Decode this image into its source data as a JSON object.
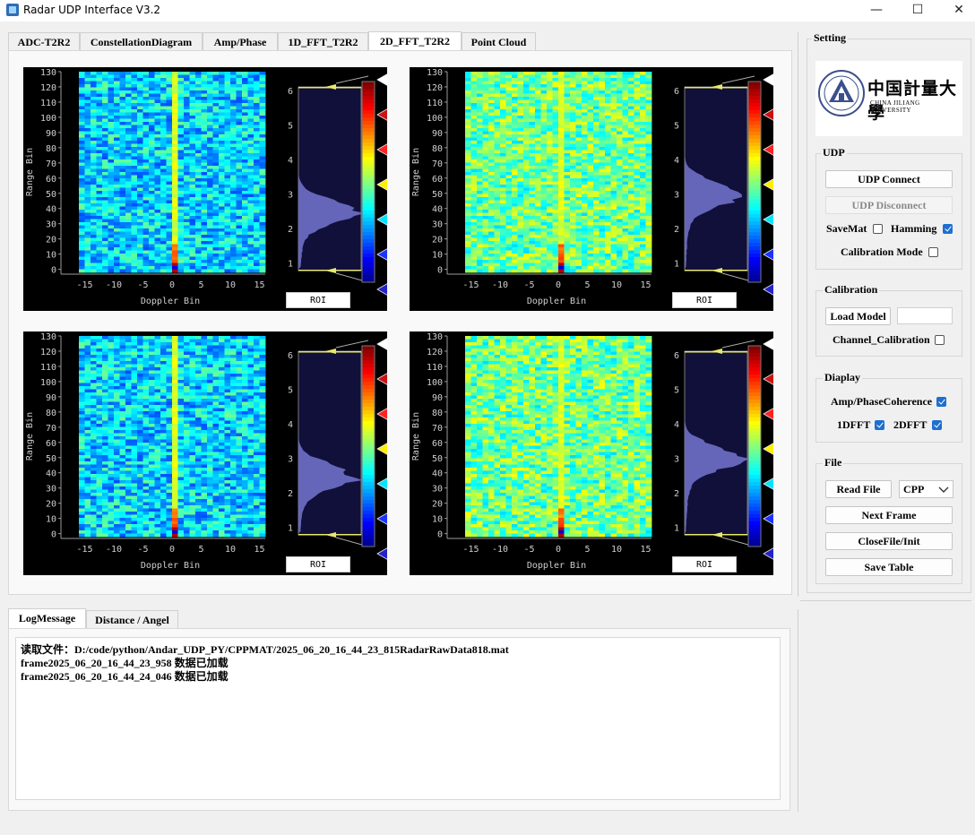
{
  "window": {
    "title": "Radar UDP Interface V3.2",
    "minimize": "—",
    "maximize": "☐",
    "close": "✕"
  },
  "tabs": [
    "ADC-T2R2",
    "ConstellationDiagram",
    "Amp/Phase",
    "1D_FFT_T2R2",
    "2D_FFT_T2R2",
    "Point Cloud"
  ],
  "active_tab": "2D_FFT_T2R2",
  "plots": {
    "y_ticks": [
      "130",
      "120",
      "110",
      "100",
      "90",
      "80",
      "70",
      "60",
      "50",
      "40",
      "30",
      "20",
      "10",
      "0"
    ],
    "x_ticks": [
      "-15",
      "-10",
      "-5",
      "0",
      "5",
      "10",
      "15"
    ],
    "xlabel": "Doppler Bin",
    "ylabel": "Range Bin",
    "hist_ticks": [
      "6",
      "5",
      "4",
      "3",
      "2",
      "1"
    ],
    "roi_label": "ROI"
  },
  "settings": {
    "title": "Setting",
    "logo_cn": "中国計量大學",
    "logo_en": "CHINA JILIANG UNIVERSITY",
    "udp": {
      "title": "UDP",
      "connect": "UDP Connect",
      "disconnect": "UDP Disconnect",
      "savemat": "SaveMat",
      "hamming": "Hamming",
      "calibration_mode": "Calibration Mode"
    },
    "calibration": {
      "title": "Calibration",
      "load_model": "Load Model",
      "channel_calibration": "Channel_Calibration"
    },
    "display": {
      "title": "Diaplay",
      "amp_phase": "Amp/PhaseCoherence",
      "fft1d": "1DFFT",
      "fft2d": "2DFFT"
    },
    "file": {
      "title": "File",
      "read_file": "Read File",
      "format": "CPP",
      "next_frame": "Next Frame",
      "close_file": "CloseFile/Init",
      "save_table": "Save Table"
    },
    "checks": {
      "savemat": false,
      "hamming": true,
      "calibration_mode": false,
      "channel_calibration": false,
      "amp_phase": true,
      "fft1d": true,
      "fft2d": true
    }
  },
  "bottom_tabs": [
    "LogMessage",
    "Distance / Angel"
  ],
  "log_lines": [
    "读取文件：D:/code/python/Andar_UDP_PY/CPPMAT/2025_06_20_16_44_23_815RadarRawData818.mat",
    "frame2025_06_20_16_44_23_958 数据已加载",
    "frame2025_06_20_16_44_24_046 数据已加载"
  ],
  "colors": {
    "accent": "#1e6fd0",
    "plot_bg": "#000000",
    "hist_bg": "#10103a"
  }
}
